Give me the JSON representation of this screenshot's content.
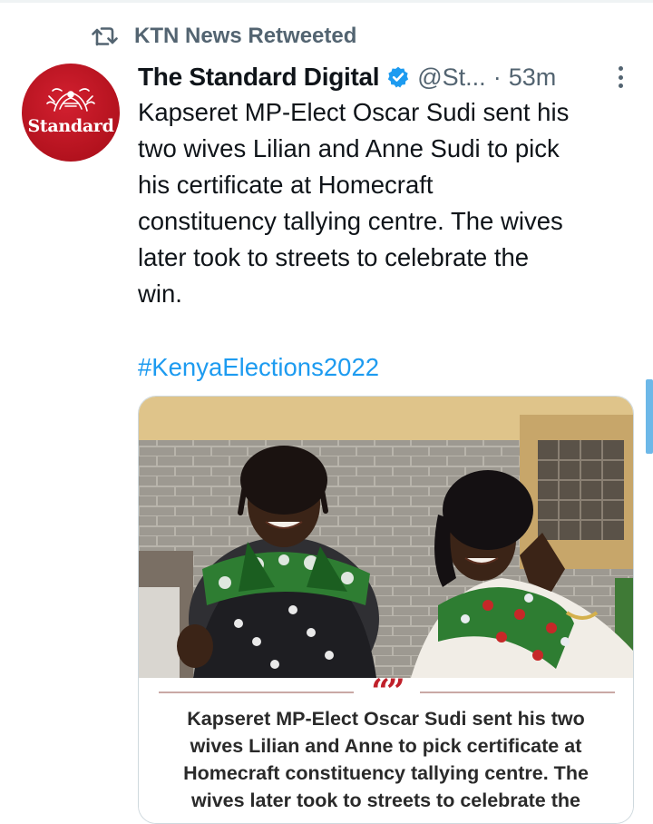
{
  "retweet": {
    "label": "KTN News Retweeted",
    "icon": "retweet-icon"
  },
  "author": {
    "display_name": "The Standard Digital",
    "handle": "@St...",
    "separator": "·",
    "time": "53m",
    "verified": true,
    "avatar_brand": "Standard",
    "avatar_color": "#b3121e"
  },
  "tweet": {
    "text": "Kapseret MP-Elect Oscar Sudi sent his\ntwo wives Lilian and Anne Sudi to pick\nhis certificate at Homecraft\nconstituency tallying centre. The wives\nlater took to streets to celebrate the\nwin.",
    "hashtag": "#KenyaElections2022"
  },
  "card": {
    "quote_mark": "“”",
    "quote_text": "Kapseret MP-Elect Oscar Sudi sent his two\nwives Lilian and Anne to pick certificate at\nHomecraft constituency tallying centre. The\nwives later took to streets to celebrate the"
  },
  "colors": {
    "link": "#1d9bf0",
    "secondary_text": "#536471",
    "verified": "#1d9bf0",
    "quote_accent": "#c0202a"
  }
}
